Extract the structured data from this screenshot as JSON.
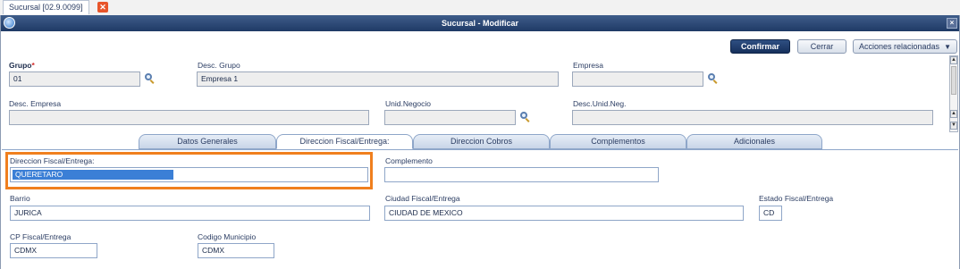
{
  "doc_tab": {
    "label": "Sucursal [02.9.0099]",
    "close": "✕"
  },
  "window": {
    "title": "Sucursal - Modificar",
    "close": "×"
  },
  "toolbar": {
    "confirm": "Confirmar",
    "close": "Cerrar",
    "related": "Acciones relacionadas",
    "related_caret": "▼"
  },
  "header": {
    "grupo": {
      "label": "Grupo",
      "required_mark": "*",
      "value": "01"
    },
    "desc_grupo": {
      "label": "Desc. Grupo",
      "value": "Empresa 1"
    },
    "empresa": {
      "label": "Empresa",
      "value": ""
    },
    "desc_empresa": {
      "label": "Desc. Empresa",
      "value": ""
    },
    "unid_negocio": {
      "label": "Unid.Negocio",
      "value": ""
    },
    "desc_unid_neg": {
      "label": "Desc.Unid.Neg.",
      "value": ""
    }
  },
  "tabs": [
    {
      "label": "Datos Generales",
      "active": false
    },
    {
      "label": "Direccion Fiscal/Entrega:",
      "active": true
    },
    {
      "label": "Direccion Cobros",
      "active": false
    },
    {
      "label": "Complementos",
      "active": false
    },
    {
      "label": "Adicionales",
      "active": false
    }
  ],
  "form": {
    "direccion": {
      "label": "Direccion Fiscal/Entrega:",
      "value": "QUERETARO"
    },
    "complemento": {
      "label": "Complemento",
      "value": ""
    },
    "barrio": {
      "label": "Barrio",
      "value": "JURICA"
    },
    "ciudad": {
      "label": "Ciudad Fiscal/Entrega",
      "value": "CIUDAD DE MEXICO"
    },
    "estado": {
      "label": "Estado Fiscal/Entrega",
      "value": "CD"
    },
    "cp": {
      "label": "CP Fiscal/Entrega",
      "value": "CDMX"
    },
    "codigo_municipio": {
      "label": "Codigo Municipio",
      "value": "CDMX"
    }
  },
  "colors": {
    "accent": "#1f3a66",
    "highlight": "#f07f1e",
    "selection": "#3b7fd6"
  },
  "icons": [
    "app-icon",
    "close-icon",
    "search-icon",
    "scroll-up-icon",
    "scroll-down-icon"
  ]
}
